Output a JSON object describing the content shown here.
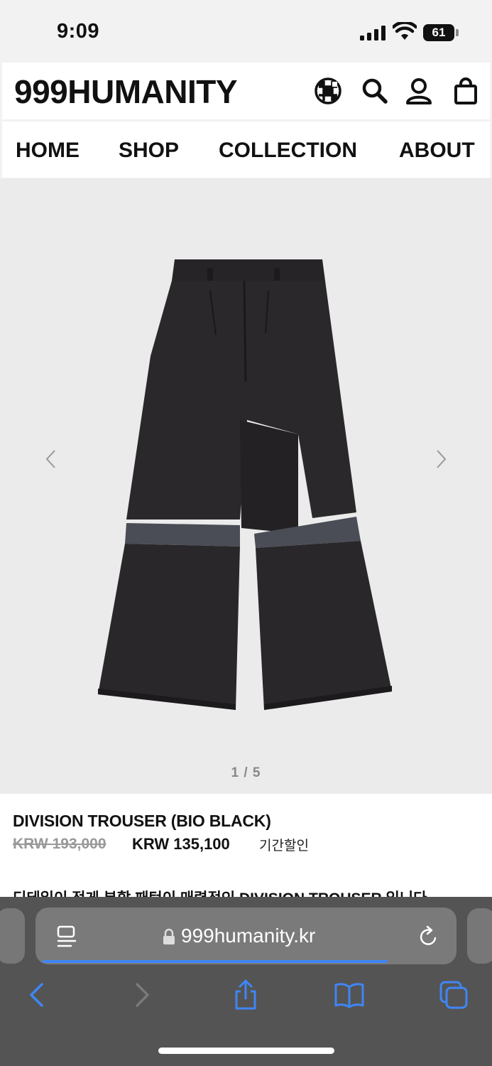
{
  "status_bar": {
    "time": "9:09",
    "battery": "61"
  },
  "header": {
    "logo": "999HUMANITY",
    "icons": [
      "globe-icon",
      "search-icon",
      "account-icon",
      "bag-icon"
    ]
  },
  "nav": {
    "items": [
      "HOME",
      "SHOP",
      "COLLECTION",
      "ABOUT"
    ]
  },
  "gallery": {
    "counter": "1 / 5"
  },
  "product": {
    "title": "DIVISION TROUSER (BIO BLACK)",
    "original_price": "KRW 193,000",
    "sale_price": "KRW 135,100",
    "badge": "기간할인",
    "description": "디테일이 적게 분할 패턴이 매력적인 DIVISION TROUSER 입니다"
  },
  "browser": {
    "url": "999humanity.kr"
  },
  "colors": {
    "accent": "#3f86f5",
    "toolbar": "#545454"
  }
}
